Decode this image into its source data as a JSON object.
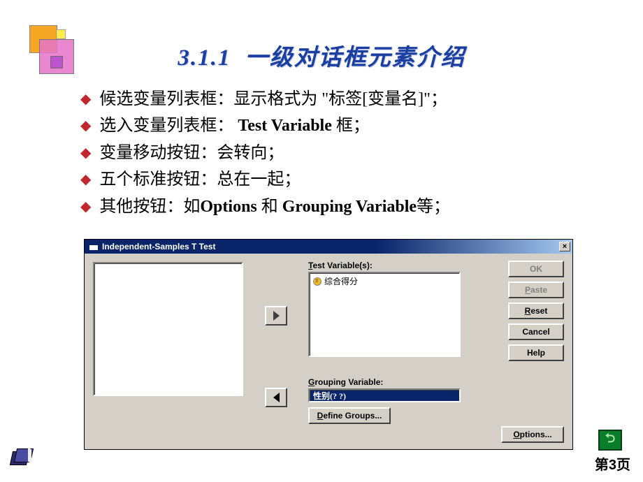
{
  "title": {
    "number": "3.1.1",
    "text": "一级对话框元素介绍"
  },
  "bullets": [
    "候选变量列表框：显示格式为 \"标签[变量名]\"；",
    "选入变量列表框： Test Variable 框；",
    "变量移动按钮：会转向；",
    "五个标准按钮：总在一起；",
    "其他按钮：如Options 和 Grouping Variable等；"
  ],
  "dialog": {
    "title": "Independent-Samples T Test",
    "test_label": "Test Variable(s):",
    "test_items": [
      "综合得分"
    ],
    "grouping_label": "Grouping Variable:",
    "grouping_value": "性别(? ?)",
    "define_label": "Define Groups...",
    "buttons": {
      "ok": "OK",
      "paste": "Paste",
      "reset": "Reset",
      "cancel": "Cancel",
      "help": "Help",
      "options": "Options..."
    },
    "close_x": "×"
  },
  "nav_symbol": "⮌",
  "page_label": "第3页"
}
